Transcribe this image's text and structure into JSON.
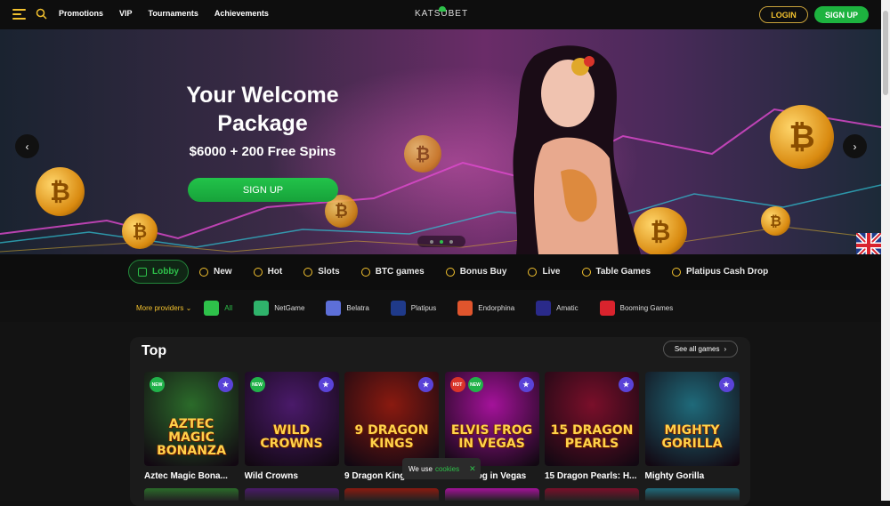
{
  "header": {
    "nav": [
      "Promotions",
      "VIP",
      "Tournaments",
      "Achievements"
    ],
    "logo": "KATSUBET",
    "login_label": "LOGIN",
    "signup_label": "SIGN UP"
  },
  "hero": {
    "title_line1": "Your Welcome",
    "title_line2": "Package",
    "subtitle": "$6000 + 200 Free Spins",
    "cta_label": "SIGN UP",
    "prev": "‹",
    "next": "›",
    "slides": 3,
    "active_slide": 2
  },
  "categories": [
    {
      "label": "Lobby",
      "icon": "lobby-icon",
      "active": true
    },
    {
      "label": "New",
      "icon": "new-icon"
    },
    {
      "label": "Hot",
      "icon": "fire-icon"
    },
    {
      "label": "Slots",
      "icon": "slots-icon"
    },
    {
      "label": "BTC games",
      "icon": "btc-icon"
    },
    {
      "label": "Bonus Buy",
      "icon": "gift-icon"
    },
    {
      "label": "Live",
      "icon": "live-icon"
    },
    {
      "label": "Table Games",
      "icon": "cards-icon"
    },
    {
      "label": "Platipus Cash Drop",
      "icon": "cashdrop-icon"
    }
  ],
  "providers": {
    "more_label": "More providers",
    "items": [
      {
        "label": "All",
        "color": "#2ec14a"
      },
      {
        "label": "NetGame",
        "color": "#2fb36b"
      },
      {
        "label": "Belatra",
        "color": "#5d6fd8"
      },
      {
        "label": "Platipus",
        "color": "#1f3a8a"
      },
      {
        "label": "Endorphina",
        "color": "#e0552d"
      },
      {
        "label": "Amatic",
        "color": "#2a2a8a"
      },
      {
        "label": "Booming Games",
        "color": "#d9232d"
      }
    ]
  },
  "section": {
    "title": "Top",
    "see_all_label": "See all games"
  },
  "games": [
    {
      "name": "Aztec Magic Bona...",
      "art": "AZTEC MAGIC BONANZA",
      "badges": [
        "NEW"
      ],
      "bg": "#2b6b2a"
    },
    {
      "name": "Wild Crowns",
      "art": "WILD CROWNS",
      "badges": [
        "NEW"
      ],
      "bg": "#4a1a6a"
    },
    {
      "name": "9 Dragon Kings",
      "art": "9 DRAGON KINGS",
      "badges": [],
      "bg": "#8a1a10"
    },
    {
      "name": "Elvis Frog in Vegas",
      "art": "ELVIS FROG IN VEGAS",
      "badges": [
        "HOT",
        "NEW"
      ],
      "bg": "#a4129a"
    },
    {
      "name": "15 Dragon Pearls: H...",
      "art": "15 DRAGON PEARLS",
      "badges": [],
      "bg": "#7a0f2a"
    },
    {
      "name": "Mighty Gorilla",
      "art": "MIGHTY GORILLA",
      "badges": [],
      "bg": "#1f6a7a"
    }
  ],
  "cookie": {
    "text": "We use",
    "link": "cookies",
    "close": "✕"
  },
  "colors": {
    "accent_green": "#2ec14a",
    "accent_gold": "#f2c12e",
    "background": "#121212"
  }
}
